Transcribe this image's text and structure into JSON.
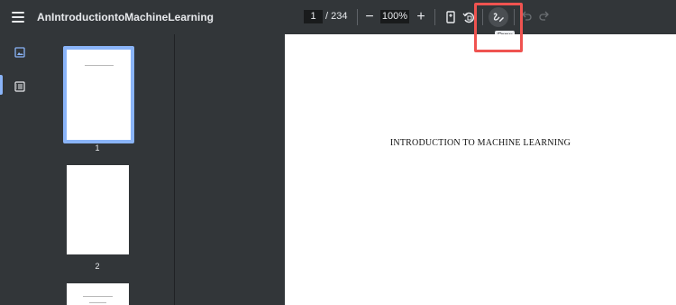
{
  "toolbar": {
    "title": "AnIntroductiontoMachineLearning",
    "page_current": "1",
    "page_total": "/ 234",
    "zoom_out_label": "−",
    "zoom_value": "100%",
    "zoom_in_label": "+",
    "tooltip": "Draw"
  },
  "sidebar": {
    "icons": [
      "thumbnails-icon",
      "outline-icon"
    ]
  },
  "thumbnails": [
    {
      "label": "1"
    },
    {
      "label": "2"
    }
  ],
  "page": {
    "heading": "INTRODUCTION TO MACHINE LEARNING"
  },
  "colors": {
    "toolbar_bg": "#323639",
    "accent": "#8ab4f8",
    "highlight": "#ef5350"
  }
}
